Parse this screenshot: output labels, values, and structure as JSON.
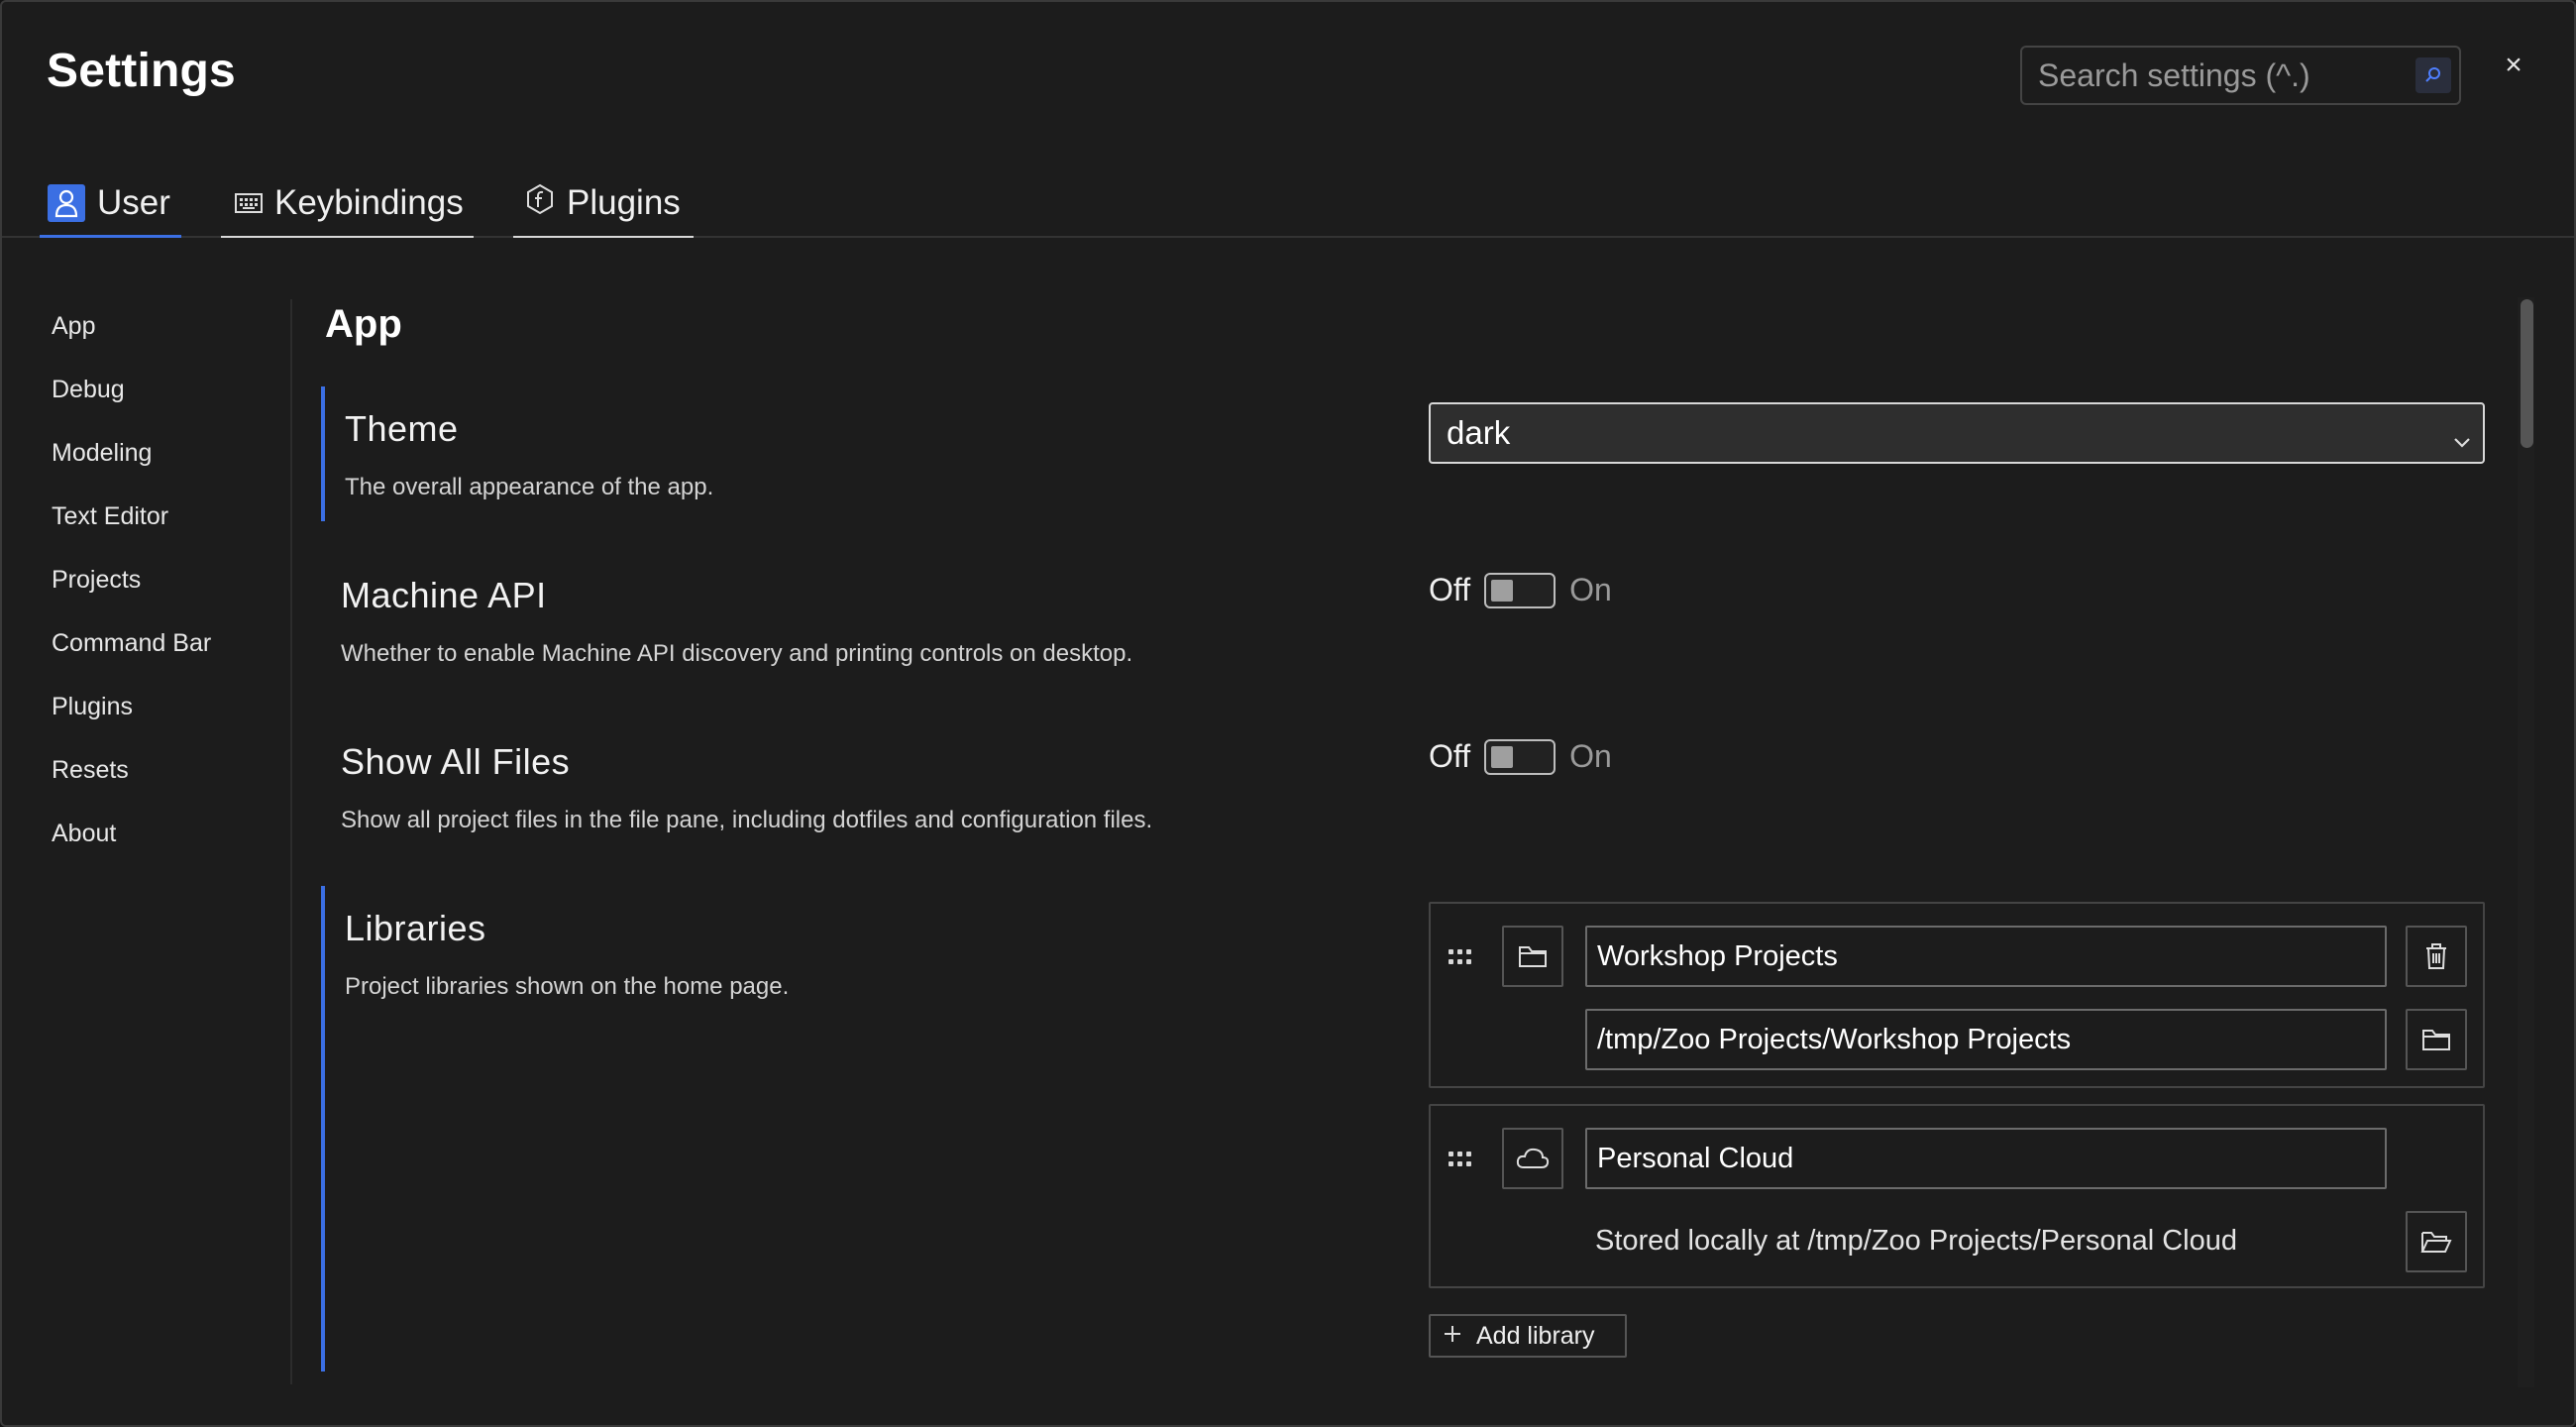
{
  "window": {
    "title": "Settings",
    "search_placeholder": "Search settings (^.)",
    "search_icon": "search-icon",
    "close_label": "×"
  },
  "tabs": [
    {
      "label": "User",
      "icon": "user-icon",
      "active": true
    },
    {
      "label": "Keybindings",
      "icon": "keyboard-icon",
      "active": false
    },
    {
      "label": "Plugins",
      "icon": "plugin-icon",
      "active": false
    }
  ],
  "sidebar": {
    "items": [
      "App",
      "Debug",
      "Modeling",
      "Text Editor",
      "Projects",
      "Command Bar",
      "Plugins",
      "Resets",
      "About"
    ]
  },
  "main": {
    "section_title": "App",
    "theme": {
      "name": "Theme",
      "description": "The overall appearance of the app.",
      "value": "dark"
    },
    "machine_api": {
      "name": "Machine API",
      "description": "Whether to enable Machine API discovery and printing controls on desktop.",
      "off_label": "Off",
      "on_label": "On",
      "enabled": false
    },
    "show_all_files": {
      "name": "Show All Files",
      "description": "Show all project files in the file pane, including dotfiles and configuration files.",
      "off_label": "Off",
      "on_label": "On",
      "enabled": false
    },
    "libraries": {
      "name": "Libraries",
      "description": "Project libraries shown on the home page.",
      "items": [
        {
          "name": "Workshop Projects",
          "path": "/tmp/Zoo Projects/Workshop Projects",
          "icon": "folder-icon"
        },
        {
          "name": "Personal Cloud",
          "storage_text": "Stored locally at /tmp/Zoo Projects/Personal Cloud",
          "icon": "cloud-icon"
        }
      ],
      "add_label": "Add library"
    }
  },
  "colors": {
    "accent": "#3b6fe3",
    "background": "#1c1c1c"
  }
}
